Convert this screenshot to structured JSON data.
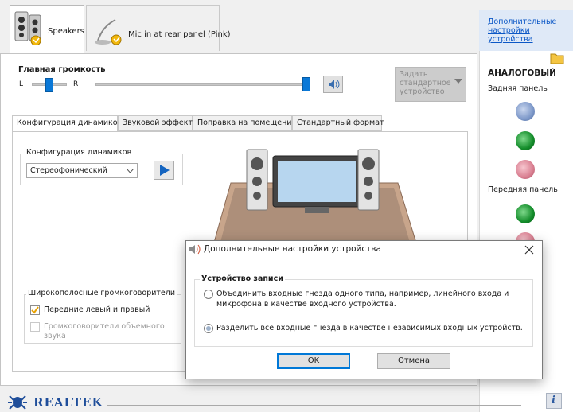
{
  "device_tabs": [
    {
      "label": "Speakers",
      "active": true
    },
    {
      "label": "Mic in at rear panel (Pink)",
      "active": false
    }
  ],
  "volume": {
    "title": "Главная громкость",
    "left_label": "L",
    "right_label": "R",
    "balance_fraction": 0.5,
    "level_fraction": 1.0,
    "default_button": "Задать стандартное устройство"
  },
  "inner_tabs": [
    {
      "label": "Конфигурация динамиков",
      "active": true
    },
    {
      "label": "Звуковой эффект",
      "active": false
    },
    {
      "label": "Поправка на помещение",
      "active": false
    },
    {
      "label": "Стандартный формат",
      "active": false
    }
  ],
  "speaker_config": {
    "group_title": "Конфигурация динамиков",
    "selected": "Стереофонический"
  },
  "fullrange": {
    "group_title": "Широкополосные громкоговорители",
    "front_label": "Передние левый и правый",
    "front_checked": true,
    "surround_label": "Громкоговорители объемного звука",
    "surround_enabled": false
  },
  "right_panel": {
    "link": "Дополнительные настройки устройства",
    "analog": "АНАЛОГОВЫЙ",
    "rear": "Задняя панель",
    "front": "Передняя панель",
    "jack_colors": {
      "blue": "#7d98c9",
      "green": "#138c2a",
      "pink": "#d97f91"
    }
  },
  "brand": "REALTEK",
  "dialog": {
    "title": "Дополнительные настройки устройства",
    "group_title": "Устройство записи",
    "option1_line1": "Объединить входные гнезда одного типа, например, линейного входа и",
    "option1_line2": "микрофона в качестве входного устройства.",
    "option2": "Разделить все входные гнезда в качестве независимых входных устройств.",
    "selected_option": 2,
    "ok": "OK",
    "cancel": "Отмена"
  }
}
